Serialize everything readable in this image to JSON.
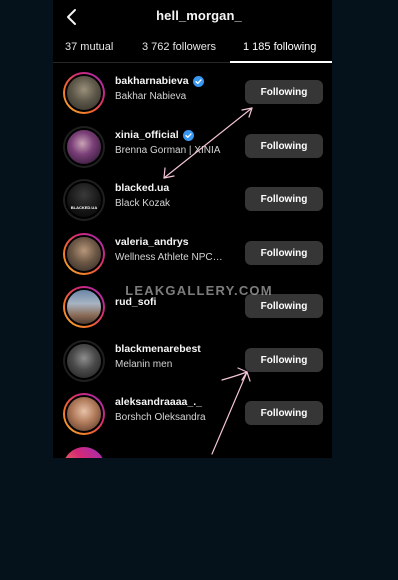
{
  "header": {
    "title": "hell_morgan_"
  },
  "tabs": [
    {
      "label": "37 mutual"
    },
    {
      "label": "3 762 followers"
    },
    {
      "label": "1 185 following"
    }
  ],
  "active_tab": "1 185 following",
  "accounts": [
    {
      "username": "bakharnabieva",
      "full_name": "Bakhar Nabieva",
      "verified": true,
      "button": "Following"
    },
    {
      "username": "xinia_official",
      "full_name": "Brenna Gorman | XINIA",
      "verified": true,
      "button": "Following"
    },
    {
      "username": "blacked.ua",
      "full_name": "Black Kozak",
      "verified": false,
      "button": "Following",
      "avatar_text": "BLACKED.UA"
    },
    {
      "username": "valeria_andrys",
      "full_name": "Wellness Athlete NPC…",
      "verified": false,
      "button": "Following"
    },
    {
      "username": "rud_sofi",
      "full_name": "",
      "verified": false,
      "button": "Following"
    },
    {
      "username": "blackmenarebest",
      "full_name": "Melanin men",
      "verified": false,
      "button": "Following"
    },
    {
      "username": "aleksandraaaa_._",
      "full_name": "Borshch Oleksandra",
      "verified": false,
      "button": "Following"
    }
  ],
  "watermark": "LEAKGALLERY.COM",
  "colors": {
    "page_background": "#05121b",
    "screen_background": "#000000",
    "button_background": "#363636",
    "verified_badge": "#3897f0",
    "annotation_arrow": "#f2c4d6",
    "story_ring": [
      "#f7b733",
      "#d62976",
      "#962fbf"
    ]
  },
  "icons": {
    "back": "chevron-left-icon",
    "verified": "verified-badge-icon"
  }
}
